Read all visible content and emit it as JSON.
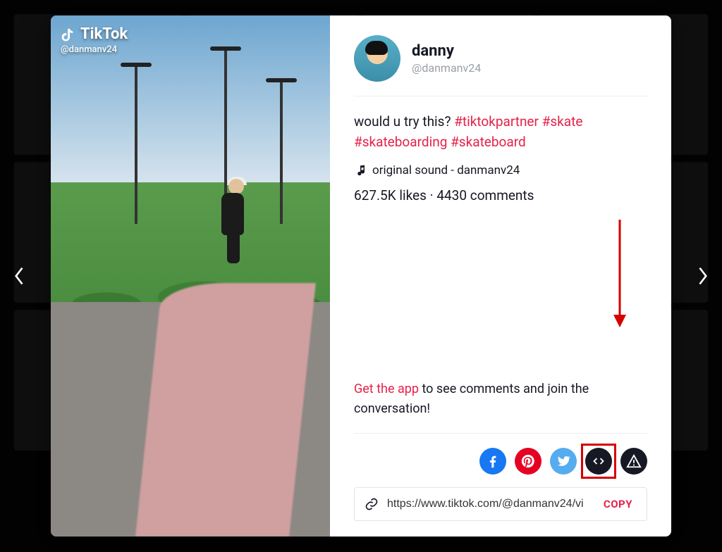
{
  "page": {
    "platform_name": "TikTok",
    "watermark_handle": "@danmanv24"
  },
  "user": {
    "display_name": "danny",
    "handle": "@danmanv24"
  },
  "post": {
    "caption_text": "would u try this? ",
    "hashtags": [
      "#tiktokpartner",
      "#skate",
      "#skateboarding",
      "#skateboard"
    ],
    "music_label": "original sound - danmanv24",
    "likes_text": "627.5K likes",
    "comments_text": "4430 comments",
    "stats_separator": " · "
  },
  "cta": {
    "prefix": "Get the app",
    "suffix": " to see comments and join the conversation!"
  },
  "share": {
    "facebook": "facebook",
    "pinterest": "pinterest",
    "twitter": "twitter",
    "embed": "embed",
    "report": "report"
  },
  "link": {
    "url": "https://www.tiktok.com/@danmanv24/vi",
    "copy_label": "COPY"
  }
}
